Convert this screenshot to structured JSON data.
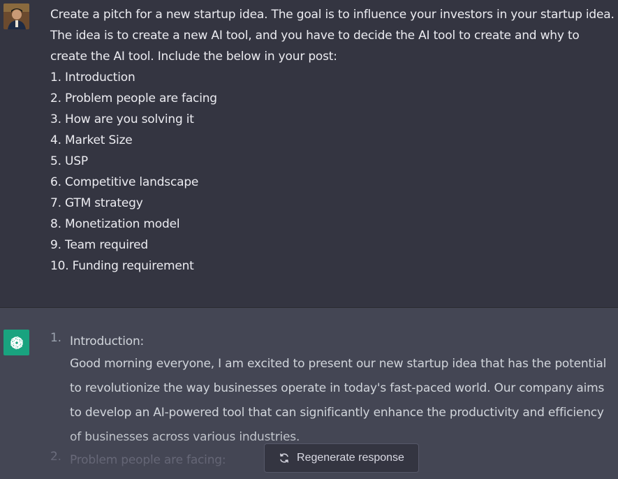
{
  "user_message": {
    "intro": "Create a pitch for a new startup idea. The goal is to influence your investors in your startup idea. The idea is to create a new AI tool, and you have to decide the AI tool to create and why to create the AI tool. Include the below in your post:",
    "items": [
      "1. Introduction",
      "2. Problem people are facing",
      "3. How are you solving it",
      "4. Market Size",
      "5. USP",
      "6. Competitive landscape",
      "7. GTM strategy",
      "8. Monetization model",
      "9. Team required",
      "10. Funding requirement"
    ]
  },
  "assistant_message": {
    "items": [
      {
        "number": "1.",
        "title": "Introduction:",
        "text": "Good morning everyone, I am excited to present our new startup idea that has the potential to revolutionize the way businesses operate in today's fast-paced world. Our company aims to develop an AI-powered tool that can significantly enhance the productivity and efficiency of businesses across various industries."
      },
      {
        "number": "2.",
        "title": "Problem people are facing:",
        "text": ""
      }
    ]
  },
  "controls": {
    "regenerate_label": "Regenerate response"
  },
  "icons": {
    "user_avatar": "user-avatar",
    "assistant_avatar": "openai-logo-icon",
    "regenerate": "refresh-icon"
  },
  "colors": {
    "user_bg": "#343541",
    "assistant_bg": "#444654",
    "gpt_logo_bg": "#19a37f"
  }
}
